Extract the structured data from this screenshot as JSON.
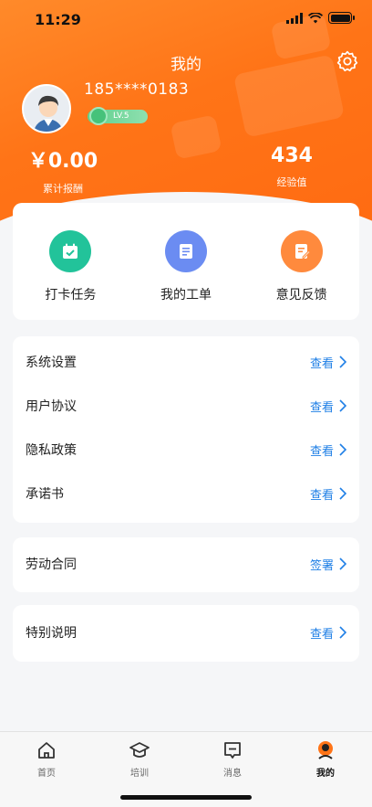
{
  "status_bar": {
    "time": "11:29"
  },
  "header": {
    "title": "我的",
    "settings_icon": "gear-icon",
    "colors": {
      "primary": "#ff7417",
      "link": "#1f7fe6",
      "level_badge": "#5fcf8c"
    }
  },
  "profile": {
    "phone": "185****0183",
    "level": "LV.5",
    "earnings_value": "￥0.00",
    "earnings_label": "累计报酬",
    "exp_value": "434",
    "exp_label": "经验值"
  },
  "quick_actions": [
    {
      "label": "打卡任务",
      "icon": "calendar-check-icon",
      "color": "#22c39a"
    },
    {
      "label": "我的工单",
      "icon": "work-order-icon",
      "color": "#6b8cf2"
    },
    {
      "label": "意见反馈",
      "icon": "feedback-edit-icon",
      "color": "#ff8a3d"
    }
  ],
  "menu_group_1": [
    {
      "label": "系统设置",
      "action": "查看"
    },
    {
      "label": "用户协议",
      "action": "查看"
    },
    {
      "label": "隐私政策",
      "action": "查看"
    },
    {
      "label": "承诺书",
      "action": "查看"
    }
  ],
  "menu_group_2": [
    {
      "label": "劳动合同",
      "action": "签署"
    }
  ],
  "menu_group_3": [
    {
      "label": "特别说明",
      "action": "查看"
    }
  ],
  "tabbar": [
    {
      "label": "首页",
      "icon": "home-icon"
    },
    {
      "label": "培训",
      "icon": "graduation-cap-icon"
    },
    {
      "label": "消息",
      "icon": "message-icon"
    },
    {
      "label": "我的",
      "icon": "profile-icon",
      "active": true
    }
  ]
}
